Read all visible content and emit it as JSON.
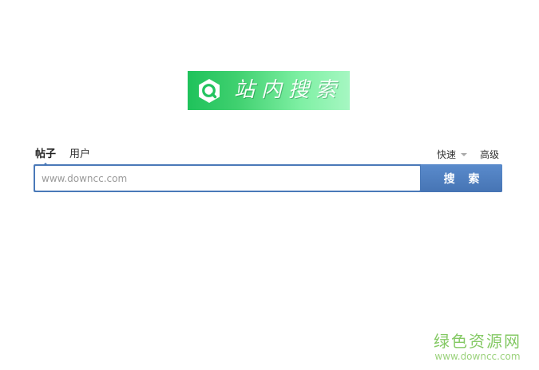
{
  "logo": {
    "title": "站内搜索",
    "icon": "magnifier-icon",
    "colors": {
      "start": "#1fc25b",
      "end": "#a6f7c2"
    }
  },
  "tabs": [
    {
      "label": "帖子",
      "active": true
    },
    {
      "label": "用户",
      "active": false
    }
  ],
  "options": {
    "quick": {
      "label": "快速",
      "icon": "triangle-down-icon"
    },
    "advanced": {
      "label": "高级"
    }
  },
  "search": {
    "placeholder": "www.downcc.com",
    "value": "",
    "button_label": "搜 索"
  },
  "watermark": {
    "name": "绿色资源网",
    "url": "www.downcc.com"
  },
  "colors": {
    "accent": "#4a79b8",
    "watermark": "#6fc04a"
  }
}
